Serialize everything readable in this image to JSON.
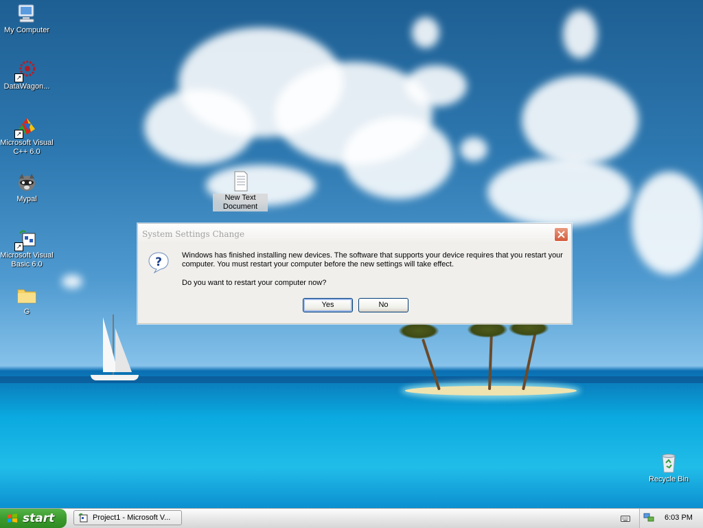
{
  "desktop": {
    "icons": [
      {
        "label_lines": [
          "My Computer"
        ],
        "icon": "computer-icon"
      },
      {
        "label_lines": [
          "DataWagon..."
        ],
        "icon": "datawagon-icon"
      },
      {
        "label_lines": [
          "Microsoft Visual",
          "C++ 6.0"
        ],
        "icon": "visual-cpp-icon"
      },
      {
        "label_lines": [
          "Mypal"
        ],
        "icon": "mypal-icon"
      },
      {
        "label_lines": [
          "Microsoft Visual",
          "Basic 6.0"
        ],
        "icon": "visual-basic-icon"
      },
      {
        "label_lines": [
          "G"
        ],
        "icon": "folder-icon"
      },
      {
        "label_lines": [
          "New Text",
          "Document"
        ],
        "icon": "text-document-icon"
      },
      {
        "label_lines": [
          "Recycle Bin"
        ],
        "icon": "recycle-bin-icon"
      }
    ]
  },
  "dialog": {
    "title": "System Settings Change",
    "icon": "question-icon",
    "message": "Windows has finished installing new devices. The software that supports your device requires that you restart your computer. You must restart your computer before the new settings will take effect.",
    "question": "Do you want to restart your computer now?",
    "yes_label": "Yes",
    "no_label": "No"
  },
  "taskbar": {
    "start_label": "start",
    "task_items": [
      {
        "label": "Project1 - Microsoft V...",
        "icon": "vb-project-icon"
      }
    ],
    "tray": {
      "clock": "6:03 PM",
      "icons": [
        "keyboard-icon",
        "network-icon"
      ]
    }
  },
  "colors": {
    "start_green": "#3c9b2d",
    "dialog_bg": "#ece9d8",
    "close_red": "#d25a3a",
    "button_border": "#003c74"
  }
}
